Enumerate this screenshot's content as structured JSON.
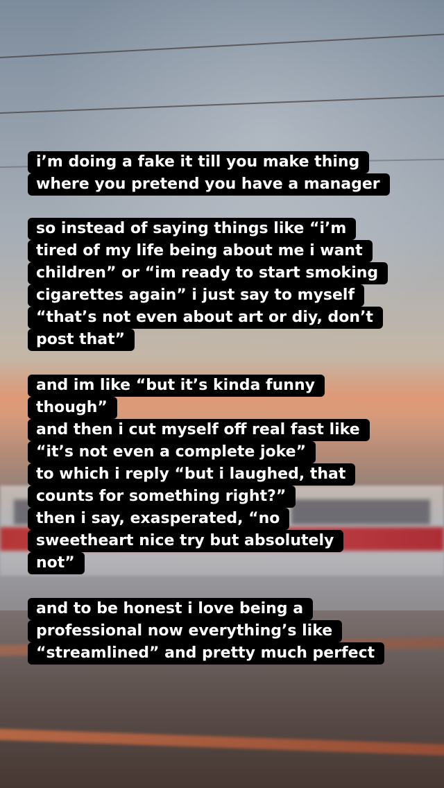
{
  "story": {
    "blocks": [
      {
        "lines": [
          "i’m doing a fake it till you make thing",
          "where you pretend you have a manager"
        ]
      },
      {
        "lines": [
          "so instead of saying things like “i’m",
          "tired of my life being about me i want",
          "children” or “im ready to start smoking",
          "cigarettes again” i just say to myself",
          "“that’s not even about art or diy, don’t",
          "post that”"
        ]
      },
      {
        "lines": [
          "and im like “but it’s kinda funny",
          "though”",
          "and then i cut myself off real fast like",
          "“it’s not even a complete joke”",
          "to which i reply “but i laughed, that",
          "counts for something right?”",
          "then i say, exasperated, “no",
          "sweetheart nice try but absolutely",
          "not”"
        ]
      },
      {
        "lines": [
          "and to be honest i love being a",
          "professional now everything’s like",
          "“streamlined” and pretty much perfect"
        ]
      }
    ]
  },
  "colors": {
    "text": "#ffffff",
    "text_background": "#000000"
  }
}
